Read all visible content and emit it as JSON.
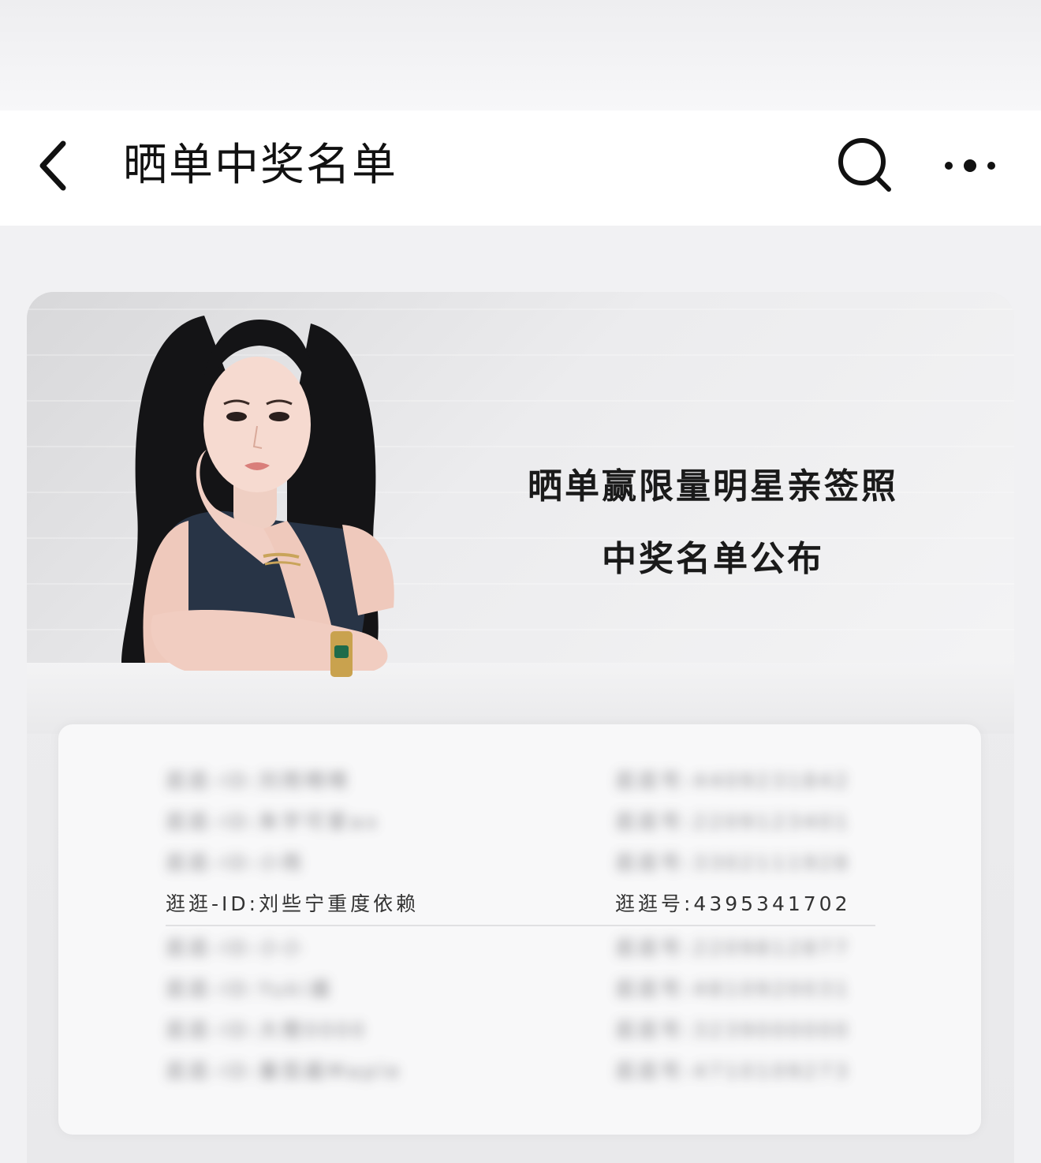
{
  "nav": {
    "title": "晒单中奖名单",
    "back_icon": "chevron-left-icon",
    "search_icon": "search-icon",
    "more_icon": "more-dots-icon"
  },
  "banner": {
    "headline_line1": "晒单赢限量明星亲签照",
    "headline_line2": "中奖名单公布"
  },
  "winners": [
    {
      "id": "逛逛-ID:刘雨晴晴",
      "num": "逛逛号:4409231842",
      "blurred": true
    },
    {
      "id": "逛逛-ID:朱宇可爱ax",
      "num": "逛逛号:2209123401",
      "blurred": true
    },
    {
      "id": "逛逛-ID:小雨",
      "num": "逛逛号:3302111928",
      "blurred": true
    },
    {
      "id": "逛逛-ID:刘些宁重度依赖",
      "num": "逛逛号:4395341702",
      "blurred": false
    },
    {
      "id": "逛逛-ID:小小",
      "num": "逛逛号:2209812877",
      "blurred": true
    },
    {
      "id": "逛逛-ID:Yuki酱",
      "num": "逛逛号:4810920031",
      "blurred": true
    },
    {
      "id": "逛逛-ID:大橙0000",
      "num": "逛逛号:3239000000",
      "blurred": true
    },
    {
      "id": "逛逛-ID:番茄酱Maple",
      "num": "逛逛号:4710109273",
      "blurred": true
    }
  ]
}
